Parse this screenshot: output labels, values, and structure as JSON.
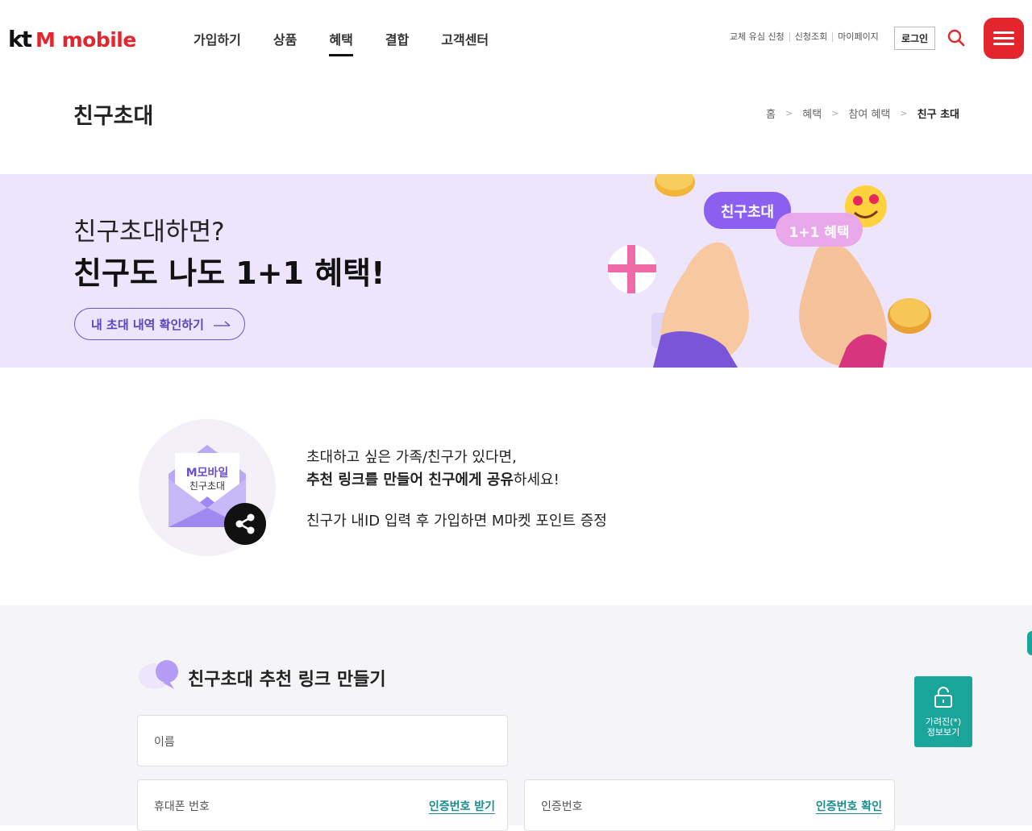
{
  "header": {
    "logo_kt": "kt",
    "logo_mobile": "M mobile",
    "nav": [
      "가입하기",
      "상품",
      "혜택",
      "결합",
      "고객센터"
    ],
    "util_links": [
      "교체 유심 신청",
      "신청조회",
      "마이페이지"
    ],
    "login_label": "로그인"
  },
  "page": {
    "title": "친구초대",
    "breadcrumb": [
      "홈",
      "혜택",
      "참여 혜택",
      "친구 초대"
    ]
  },
  "hero": {
    "sub": "친구초대하면?",
    "main": "친구도 나도 1+1 혜택!",
    "button_label": "내 초대 내역 확인하기",
    "bubble1": "친구초대",
    "bubble2": "1+1 혜택"
  },
  "intro": {
    "env_line1": "M모바일",
    "env_line2": "친구초대",
    "line1": "초대하고 싶은 가족/친구가 있다면,",
    "line2_bold": "추천 링크를 만들어 친구에게 공유",
    "line2_rest": "하세요!",
    "line3": "친구가 내ID 입력 후 가입하면 M마켓 포인트 증정"
  },
  "form": {
    "title": "친구초대 추천 링크 만들기",
    "name_label": "이름",
    "phone_label": "휴대폰 번호",
    "phone_action": "인증번호 받기",
    "code_label": "인증번호",
    "code_action": "인증번호 확인"
  },
  "mask_button": {
    "label": "가려진(*)\n정보보기"
  },
  "colors": {
    "brand_red": "#e3262d",
    "hero_bg": "#ece5fb",
    "accent_purple": "#6b55c8",
    "teal": "#1aa59a",
    "link_teal": "#1a8c8f"
  }
}
